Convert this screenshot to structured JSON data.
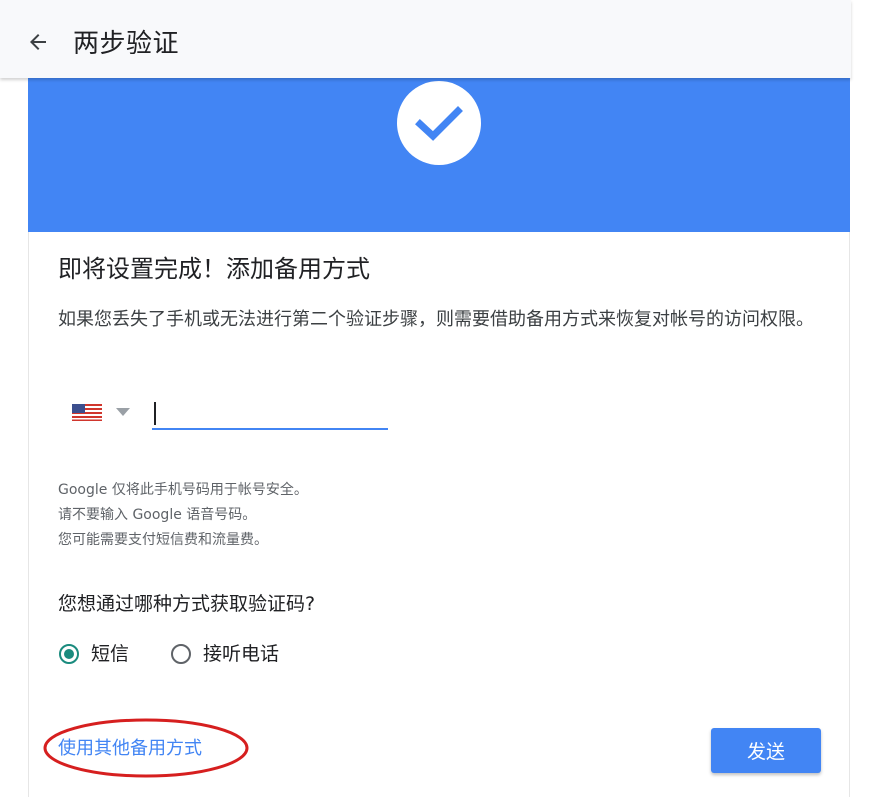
{
  "header": {
    "title": "两步验证",
    "back_icon": "arrow-back-icon"
  },
  "banner": {
    "color": "#4285f4",
    "icon": "checkmark-icon"
  },
  "main": {
    "heading": "即将设置完成！添加备用方式",
    "description": "如果您丢失了手机或无法进行第二个验证步骤，则需要借助备用方式来恢复对帐号的访问权限。",
    "country": {
      "flag": "us-flag-icon",
      "dropdown_icon": "caret-down-icon"
    },
    "phone_input": {
      "value": "",
      "placeholder": ""
    },
    "notes": [
      "Google 仅将此手机号码用于帐号安全。",
      "请不要输入 Google 语音号码。",
      "您可能需要支付短信费和流量费。"
    ],
    "question": "您想通过哪种方式获取验证码?",
    "options": [
      {
        "label": "短信",
        "selected": true
      },
      {
        "label": "接听电话",
        "selected": false
      }
    ],
    "other_link": "使用其他备用方式",
    "send_button": "发送"
  },
  "colors": {
    "accent": "#4285f4",
    "radio_selected": "#1a8b7e",
    "annotation": "#d61f1f"
  }
}
